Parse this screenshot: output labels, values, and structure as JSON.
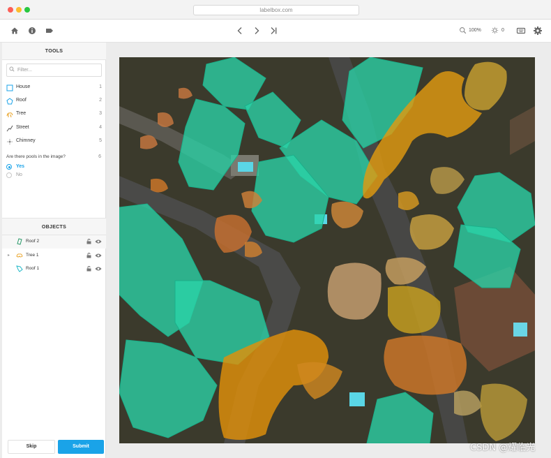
{
  "browser": {
    "url": "labelbox.com"
  },
  "toolbar": {
    "zoom": "100%",
    "brightness": "0"
  },
  "tools_panel": {
    "title": "TOOLS",
    "filter_placeholder": "Filter...",
    "tools": [
      {
        "label": "House",
        "key": "1",
        "icon": "bounding-box-icon",
        "color": "#1aa3e8"
      },
      {
        "label": "Roof",
        "key": "2",
        "icon": "polygon-icon",
        "color": "#1aa3e8"
      },
      {
        "label": "Tree",
        "key": "3",
        "icon": "tree-icon",
        "color": "#e8a020"
      },
      {
        "label": "Street",
        "key": "4",
        "icon": "polyline-icon",
        "color": "#555555"
      },
      {
        "label": "Chimney",
        "key": "5",
        "icon": "point-icon",
        "color": "#888888"
      }
    ],
    "question": {
      "text": "Are there pools in the image?",
      "key": "6",
      "options": [
        {
          "label": "Yes",
          "selected": true
        },
        {
          "label": "No",
          "selected": false
        }
      ]
    }
  },
  "objects_panel": {
    "title": "OBJECTS",
    "objects": [
      {
        "label": "Roof 2",
        "icon": "polygon-green-icon",
        "expandable": false
      },
      {
        "label": "Tree 1",
        "icon": "tree-icon",
        "expandable": true
      },
      {
        "label": "Roof 1",
        "icon": "polygon-teal-icon",
        "expandable": false
      }
    ]
  },
  "actions": {
    "skip": "Skip",
    "submit": "Submit"
  },
  "watermark": "CSDN @耀临光",
  "colors": {
    "accent": "#1aa3e8",
    "roof_overlay": "#2ad4a8",
    "tree_overlay": "#e0900a",
    "tree_alt_overlay": "#c8a040"
  }
}
